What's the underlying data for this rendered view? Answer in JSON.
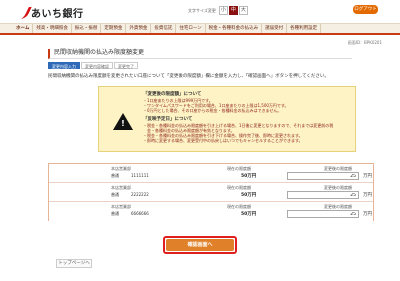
{
  "header": {
    "bank_name": "あいち銀行",
    "font_size_label": "文字サイズ変更",
    "font_sizes": [
      "小",
      "中",
      "大"
    ],
    "logout_label": "ログアウト"
  },
  "nav": {
    "items": [
      "ホーム",
      "残高・明細照会",
      "振込・振替",
      "定期預金",
      "外貨預金",
      "投資信託",
      "住宅ローン",
      "税金・各種料金の払込み",
      "諸届受付",
      "各種利用設定"
    ]
  },
  "screen_id": "画面ID：BPK0201",
  "page_title": "民間収納機関の払込み限度額変更",
  "steps": [
    "変更内容入力",
    "変更内容確認",
    "変更完了"
  ],
  "intro": "民間収納機関の払込み限度額を変更されたい口座について「変更後の限度額」欄に金額を入力し、「確認画面へ」ボタンを押してください。",
  "notice": {
    "warn_mark": "!",
    "section1_title": "「変更後の限度額」について",
    "section1_lines": [
      "・1口座あたりの上限は999万円です。",
      "・ワンタイムパスワードをご利用の場合、1口座あたりの上限は1,500万円です。",
      "・0万円とした場合、その口座からの税金・各種料金の払込みはできません。"
    ],
    "section2_title": "「反映予定日」について",
    "section2_lines": [
      "・税金・各種料金の払込み限度額を引き上げる場合、1日後に変更となりますので、それまでは変更前の税",
      "　金・各種料金の払込み限度額が有効となります。",
      "・税金・各種料金の払込み限度額を引き下げる場合、操作完了後、即時に変更されます。",
      "・即時に変更する場合、変更受付中の払戻しはいつでもキャンセルすることができます。"
    ]
  },
  "accounts": [
    {
      "kouza_label": "本店営業部",
      "type": "普通",
      "number": "1111111",
      "limit_label": "現在の限度額",
      "limit_value": "50万円",
      "new_label": "変更後の限度額",
      "new_value": "25",
      "unit": "万円"
    },
    {
      "kouza_label": "本店営業部",
      "type": "普通",
      "number": "2222222",
      "limit_label": "現在の限度額",
      "limit_value": "50万円",
      "new_label": "変更後の限度額",
      "new_value": "25",
      "unit": "万円"
    },
    {
      "kouza_label": "本店営業部",
      "type": "普通",
      "number": "6666666",
      "limit_label": "現在の限度額",
      "limit_value": "50万円",
      "new_label": "変更後の限度額",
      "new_value": "25",
      "unit": "万円"
    }
  ],
  "confirm_label": "確認画面へ",
  "top_link": "トップページへ"
}
